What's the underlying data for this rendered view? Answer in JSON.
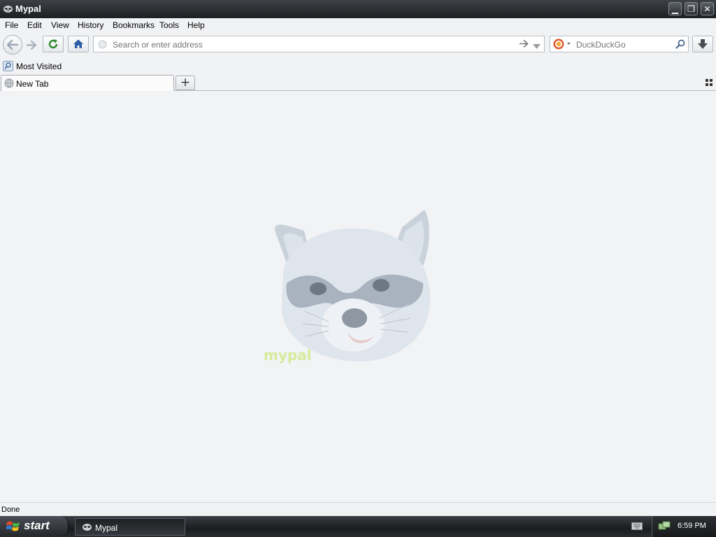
{
  "window": {
    "title": "Mypal",
    "min_symbol": "▁",
    "max_symbol": "❐",
    "close_symbol": "✕"
  },
  "menu": {
    "items": [
      "File",
      "Edit",
      "View",
      "History",
      "Bookmarks",
      "Tools",
      "Help"
    ]
  },
  "navbar": {
    "url_placeholder": "Search or enter address",
    "search_engine": "DuckDuckGo"
  },
  "bookmarks": {
    "items": [
      "Most Visited"
    ]
  },
  "tabs": {
    "items": [
      "New Tab"
    ],
    "new_tab_symbol": "+"
  },
  "content": {
    "logo_text": "mypal"
  },
  "status": {
    "text": "Done"
  },
  "taskbar": {
    "start_label": "start",
    "task_label": "Mypal",
    "clock": "6:59 PM"
  },
  "colors": {
    "titlebar": "#2b2e32",
    "content_bg": "#f2f3f5",
    "home_icon": "#2b5fa8",
    "reload_icon": "#2f8a2f"
  }
}
